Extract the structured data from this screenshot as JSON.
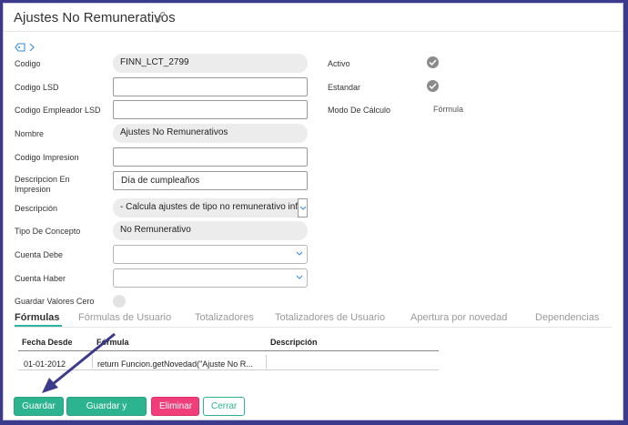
{
  "header": {
    "title": "Ajustes No Remunerativos",
    "link_icon": "link-icon"
  },
  "tag_row": {
    "icon": "tag-icon",
    "chevron": "chevron-right-icon"
  },
  "form": {
    "codigo": {
      "label": "Codigo",
      "value": "FINN_LCT_2799"
    },
    "codigo_lsd": {
      "label": "Codigo LSD",
      "value": ""
    },
    "codigo_empleador_lsd": {
      "label": "Codigo Empleador LSD",
      "value": ""
    },
    "nombre": {
      "label": "Nombre",
      "value": "Ajustes No Remunerativos"
    },
    "codigo_impresion": {
      "label": "Codigo Impresion",
      "value": ""
    },
    "descripcion_impresion": {
      "label_line1": "Descripcion En",
      "label_line2": "Impresion",
      "value": "Día de cumpleaños"
    },
    "descripcion": {
      "label": "Descripción",
      "value": "- Calcula ajustes de tipo no remunerativo info"
    },
    "tipo_concepto": {
      "label": "Tipo De Concepto",
      "value": "No Remunerativo"
    },
    "cuenta_debe": {
      "label": "Cuenta Debe",
      "value": ""
    },
    "cuenta_haber": {
      "label": "Cuenta Haber",
      "value": ""
    },
    "guardar_valores_cero": {
      "label": "Guardar Valores Cero"
    }
  },
  "right": {
    "activo": {
      "label": "Activo"
    },
    "estandar": {
      "label": "Estandar"
    },
    "modo_calculo": {
      "label": "Modo De Cálculo",
      "value": "Fórmula"
    }
  },
  "tabs": [
    {
      "label": "Fórmulas",
      "active": true
    },
    {
      "label": "Fórmulas de Usuario"
    },
    {
      "label": "Totalizadores"
    },
    {
      "label": "Totalizadores de Usuario"
    },
    {
      "label": "Apertura por novedad"
    },
    {
      "label": "Dependencias"
    }
  ],
  "table": {
    "headers": [
      "Fecha Desde",
      "Fórmula",
      "Descripción"
    ],
    "rows": [
      [
        "01-01-2012",
        "return Funcion.getNovedad(\"Ajuste No R...",
        ""
      ]
    ]
  },
  "buttons": {
    "save": "Guardar",
    "save_new": "Guardar y nuevo",
    "delete": "Eliminar",
    "close": "Cerrar"
  },
  "colors": {
    "accent": "#2cb38f",
    "danger": "#f03e7a",
    "frame": "#3b3a8c",
    "annotation_arrow": "#3b3a8c"
  }
}
